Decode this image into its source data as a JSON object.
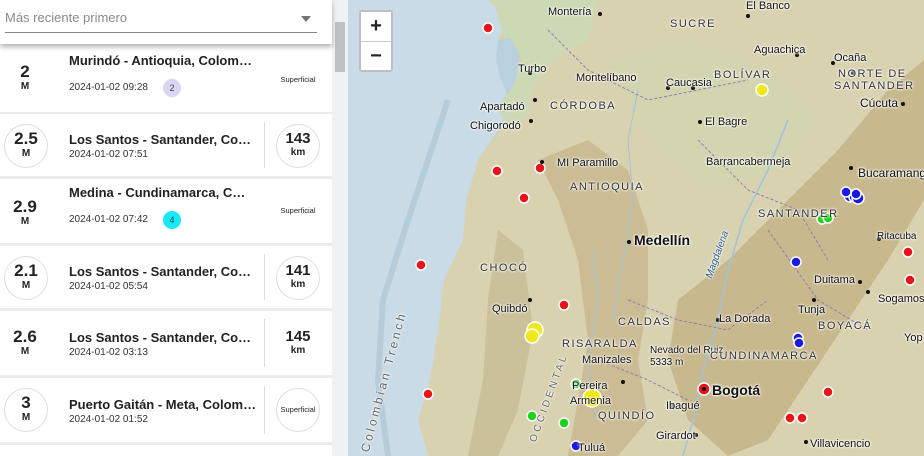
{
  "sort": {
    "selected": "Más reciente primero"
  },
  "events": [
    {
      "magnitude": "2",
      "unit": "M",
      "title": "Murindó - Antioquia, Colombia",
      "time": "2024-01-02 09:28",
      "badge": "2",
      "badge_color": "#d9d6f2",
      "depth": "",
      "depth_unit": "",
      "depth_label": "Superficial"
    },
    {
      "magnitude": "2.5",
      "unit": "M",
      "title": "Los Santos - Santander, Colombia",
      "time": "2024-01-02 07:51",
      "badge": "",
      "depth": "143",
      "depth_unit": "km",
      "depth_label": ""
    },
    {
      "magnitude": "2.9",
      "unit": "M",
      "title": "Medina - Cundinamarca, Colombia",
      "time": "2024-01-02 07:42",
      "badge": "4",
      "badge_color": "#18e8f4",
      "depth": "",
      "depth_unit": "",
      "depth_label": "Superficial"
    },
    {
      "magnitude": "2.1",
      "unit": "M",
      "title": "Los Santos - Santander, Colombia",
      "time": "2024-01-02 05:54",
      "badge": "",
      "depth": "141",
      "depth_unit": "km",
      "depth_label": ""
    },
    {
      "magnitude": "2.6",
      "unit": "M",
      "title": "Los Santos - Santander, Colombia",
      "time": "2024-01-02 03:13",
      "badge": "",
      "depth": "145",
      "depth_unit": "km",
      "depth_label": ""
    },
    {
      "magnitude": "3",
      "unit": "M",
      "title": "Puerto Gaitán - Meta, Colombia",
      "time": "2024-01-02 01:52",
      "badge": "",
      "depth": "",
      "depth_unit": "",
      "depth_label": "Superficial"
    }
  ],
  "map": {
    "zoom_in": "+",
    "zoom_out": "−",
    "colors": {
      "red": "#e8141b",
      "green": "#1ed21e",
      "blue": "#1a1ae0",
      "yellow": "#f0e81a"
    },
    "labels": {
      "monteria": "Montería",
      "el_banco": "El Banco",
      "sucre": "SUCRE",
      "aguachica": "Aguachica",
      "ocana": "Ocaña",
      "bolivar": "BOLÍVAR",
      "norte_santander_1": "NORTE DE",
      "norte_santander_2": "SANTANDER",
      "cucuta": "Cúcuta",
      "turbo": "Turbo",
      "montelibano": "Montelíbano",
      "caucasia": "Caucasia",
      "apartado": "Apartadó",
      "cordoba": "CÓRDOBA",
      "chigorodo": "Chigorodó",
      "el_bagre": "El Bagre",
      "barrancabermeja": "Barrancabermeja",
      "bucaramanga": "Bucaramanga",
      "mi_paramillo": "MI Paramillo",
      "antioquia": "ANTIOQUIA",
      "santander": "SANTANDER",
      "medellin": "Medellín",
      "magdalena": "Magdalena",
      "ritacuba": "Ritacuba",
      "choco": "CHOCÓ",
      "duitama": "Duitama",
      "tunja": "Tunja",
      "sogamoso": "Sogamos",
      "quibdo": "Quibdó",
      "caldas": "CALDAS",
      "la_dorada": "La Dorada",
      "boyaca": "BOYACÁ",
      "yopal": "Yop",
      "risaralda": "RISARALDA",
      "nevado": "Nevado del Ruiz",
      "nevado_alt": "5333 m",
      "manizales": "Manizales",
      "cundinamarca": "CUNDINAMARCA",
      "pereira": "Pereira",
      "armenia": "Armenia",
      "bogota": "Bogotá",
      "quindio": "QUINDÍO",
      "ibague": "Ibagué",
      "girardot": "Girardot",
      "villavicencio": "Villavicencio",
      "tulua": "Tuluá",
      "trench": "Colombian Trench",
      "occidental": "OCCIDENTAL"
    }
  }
}
